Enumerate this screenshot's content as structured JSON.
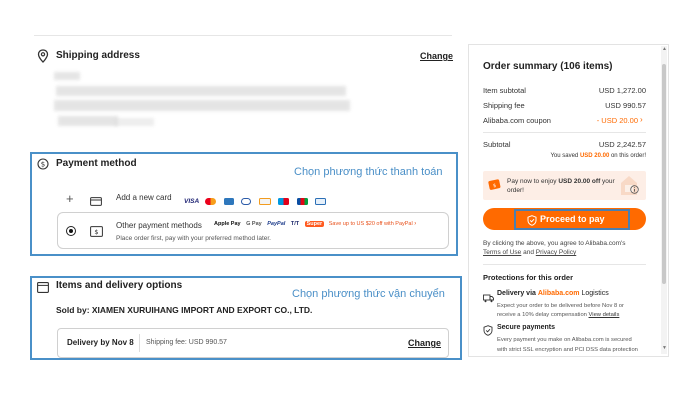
{
  "shipping": {
    "title": "Shipping address",
    "change": "Change"
  },
  "payment": {
    "title": "Payment method",
    "annotation": "Chọn phương thức thanh toán",
    "add_card": "Add a new card",
    "card_logos": [
      "VISA",
      "Mastercard",
      "Amex",
      "Diners",
      "Discover",
      "Maestro",
      "JCB",
      "UnionPay"
    ],
    "other_title": "Other payment methods",
    "other_logos": [
      "Apple Pay",
      "G Pay",
      "PayPal",
      "T/T",
      "Super"
    ],
    "promo": "Save up to US $20 off with PayPal",
    "other_desc": "Place order first, pay with your preferred method later."
  },
  "items": {
    "title": "Items and delivery options",
    "annotation": "Chọn phương thức vận chuyển",
    "seller": "Sold by: XIAMEN XURUIHANG IMPORT AND EXPORT CO., LTD.",
    "delivery": "Delivery by Nov 8",
    "shipping_fee": "Shipping fee: USD 990.57",
    "change": "Change"
  },
  "summary": {
    "title": "Order summary (106 items)",
    "rows": [
      {
        "label": "Item subtotal",
        "value": "USD 1,272.00"
      },
      {
        "label": "Shipping fee",
        "value": "USD 990.57"
      },
      {
        "label": "Alibaba.com coupon",
        "value": "- USD 20.00"
      }
    ],
    "subtotal_label": "Subtotal",
    "subtotal_value": "USD 2,242.57",
    "saved_prefix": "You saved",
    "saved_amount": "USD 20.00",
    "saved_suffix": "on this order!",
    "paynow_prefix": "Pay now to enjoy",
    "paynow_amount": "USD 20.00 off",
    "paynow_suffix": "your order!",
    "proceed": "Proceed to pay",
    "agree_text": "By clicking the above, you agree to Alibaba.com's",
    "terms": "Terms of Use",
    "and": "and",
    "privacy": "Privacy Policy",
    "protections_title": "Protections for this order",
    "delivery_via": "Delivery via",
    "alibaba_logistics": "Alibaba.com",
    "logistics": "Logistics",
    "delivery_desc_1": "Expect your order to be delivered before Nov 8 or",
    "delivery_desc_2": "receive a 10% delay compensation",
    "view_details": "View details",
    "secure_title": "Secure payments",
    "secure_desc_1": "Every payment you make on Alibaba.com is secured",
    "secure_desc_2": "with strict SSL encryption and PCI DSS data protection"
  },
  "colors": {
    "accent": "#ff6a00",
    "annotation": "#4a90c8",
    "discount": "#ff6a00"
  }
}
